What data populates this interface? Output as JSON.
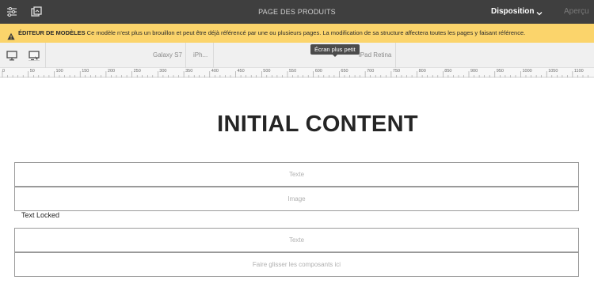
{
  "header": {
    "title": "PAGE DES PRODUITS",
    "mode_label": "Disposition",
    "preview_label": "Aperçu",
    "icons": [
      "page-properties-icon",
      "publish-icon",
      "chevron-down-icon"
    ]
  },
  "banner": {
    "strong": "ÉDITEUR DE MODÈLES",
    "message": " Ce modèle n’est plus un brouillon et peut être déjà référencé par une ou plusieurs pages. La modification de sa structure affectera toutes les pages y faisant référence.",
    "icon": "warning-icon"
  },
  "emulator": {
    "devices": [
      "Galaxy S7",
      "iPh...",
      "iPad Retina"
    ],
    "tooltip": "Écran plus petit",
    "icons": [
      "desktop-icon",
      "device-ruler-icon"
    ]
  },
  "ruler": {
    "labels": [
      "0",
      "50",
      "100",
      "150",
      "200",
      "250",
      "300",
      "350",
      "400",
      "450",
      "500",
      "550",
      "600",
      "650",
      "700",
      "750",
      "800",
      "850",
      "900",
      "950",
      "1000",
      "1050",
      "1100"
    ]
  },
  "content": {
    "heading": "INITIAL CONTENT",
    "placeholder_text": "Texte",
    "placeholder_image": "Image",
    "locked_text": "Text Locked",
    "placeholder_text_2": "Texte",
    "placeholder_drop": "Faire glisser les composants ici"
  },
  "colors": {
    "header_bg": "#3f3f3f",
    "banner_bg": "#fbd46b",
    "toolbar_bg": "#f0f0f0"
  }
}
